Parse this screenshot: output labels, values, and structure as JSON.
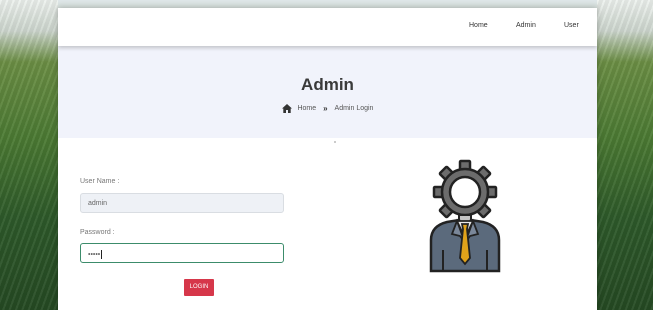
{
  "nav": {
    "items": [
      "Home",
      "Admin",
      "User"
    ]
  },
  "hero": {
    "title": "Admin",
    "breadcrumb": {
      "home": "Home",
      "current": "Admin Login"
    }
  },
  "form": {
    "username": {
      "label": "User Name :",
      "value": "admin"
    },
    "password": {
      "label": "Password :",
      "value": "•••••"
    },
    "login_label": "LOGIN"
  },
  "colors": {
    "button": "#d6374a",
    "active_border": "#3c8c6b",
    "hero_bg": "#f1f3fb"
  },
  "icons": {
    "breadcrumb_home": "home-icon",
    "breadcrumb_sep": "double-chevron-right-icon",
    "illustration": "admin-gear-person-icon"
  }
}
